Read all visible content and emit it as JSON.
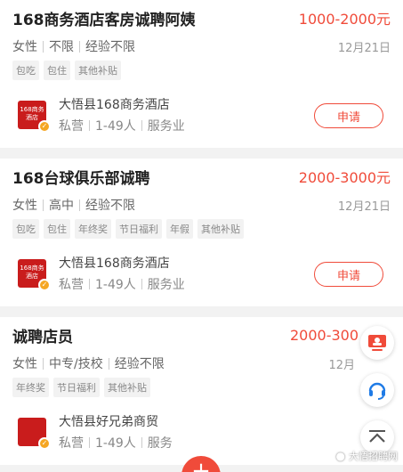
{
  "jobs": [
    {
      "title": "168商务酒店客房诚聘阿姨",
      "salary": "1000-2000元",
      "requirements": [
        "女性",
        "不限",
        "经验不限"
      ],
      "date": "12月21日",
      "tags": [
        "包吃",
        "包住",
        "其他补贴"
      ],
      "company": {
        "name": "大悟县168商务酒店",
        "meta": [
          "私营",
          "1-49人",
          "服务业"
        ],
        "logo_text": "168商务酒店"
      },
      "apply_label": "申请"
    },
    {
      "title": "168台球俱乐部诚聘",
      "salary": "2000-3000元",
      "requirements": [
        "女性",
        "高中",
        "经验不限"
      ],
      "date": "12月21日",
      "tags": [
        "包吃",
        "包住",
        "年终奖",
        "节日福利",
        "年假",
        "其他补贴"
      ],
      "company": {
        "name": "大悟县168商务酒店",
        "meta": [
          "私营",
          "1-49人",
          "服务业"
        ],
        "logo_text": "168商务酒店"
      },
      "apply_label": "申请"
    },
    {
      "title": "诚聘店员",
      "salary": "2000-300",
      "requirements": [
        "女性",
        "中专/技校",
        "经验不限"
      ],
      "date": "12月",
      "tags": [
        "年终奖",
        "节日福利",
        "其他补贴"
      ],
      "company": {
        "name": "大悟县好兄弟商贸",
        "meta": [
          "私营",
          "1-49人",
          "服务"
        ],
        "logo_text": ""
      },
      "apply_label": ""
    }
  ],
  "floating": {
    "monitor_icon": "monitor-icon",
    "service_icon": "headset-icon",
    "top_icon": "chevron-up-icon",
    "fab_label": "+"
  },
  "watermark": "大悟招聘网",
  "colors": {
    "accent": "#f04b3a",
    "badge": "#f5a623",
    "logo_bg": "#c91c1c"
  }
}
